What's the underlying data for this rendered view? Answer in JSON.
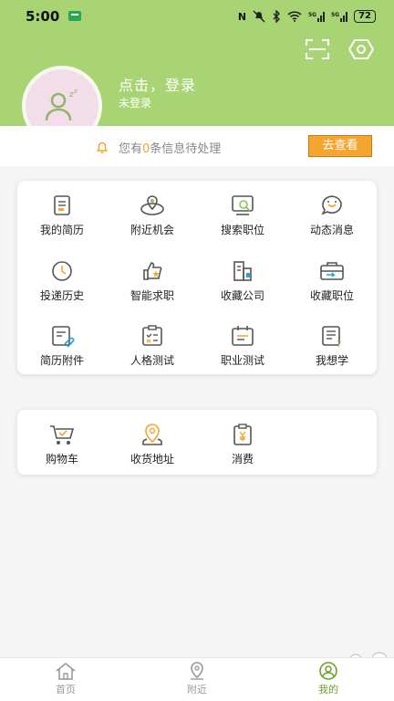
{
  "status": {
    "time": "5:00",
    "battery": "72"
  },
  "profile": {
    "title": "点击，登录",
    "subtitle": "未登录"
  },
  "notice": {
    "prefix": "您有",
    "count": "0",
    "suffix": "条信息待处理",
    "button": "去查看"
  },
  "menu": [
    {
      "label": "我的简历",
      "icon": "resume-icon"
    },
    {
      "label": "附近机会",
      "icon": "nearby-opportunity-icon"
    },
    {
      "label": "搜索职位",
      "icon": "search-job-icon"
    },
    {
      "label": "动态消息",
      "icon": "message-icon"
    },
    {
      "label": "投递历史",
      "icon": "history-icon"
    },
    {
      "label": "智能求职",
      "icon": "smart-job-icon"
    },
    {
      "label": "收藏公司",
      "icon": "favorite-company-icon"
    },
    {
      "label": "收藏职位",
      "icon": "favorite-job-icon"
    },
    {
      "label": "简历附件",
      "icon": "resume-attachment-icon"
    },
    {
      "label": "人格测试",
      "icon": "personality-test-icon"
    },
    {
      "label": "职业测试",
      "icon": "career-test-icon"
    },
    {
      "label": "我想学",
      "icon": "learn-icon"
    }
  ],
  "shop": [
    {
      "label": "购物车",
      "icon": "cart-icon"
    },
    {
      "label": "收货地址",
      "icon": "address-icon"
    },
    {
      "label": "消费",
      "icon": "consumption-icon"
    }
  ],
  "tabs": [
    {
      "label": "首页",
      "icon": "home-icon"
    },
    {
      "label": "附近",
      "icon": "location-icon"
    },
    {
      "label": "我的",
      "icon": "profile-icon"
    }
  ],
  "colors": {
    "header": "#a9d473",
    "accent": "#f4a62f",
    "active": "#6aa12f"
  }
}
